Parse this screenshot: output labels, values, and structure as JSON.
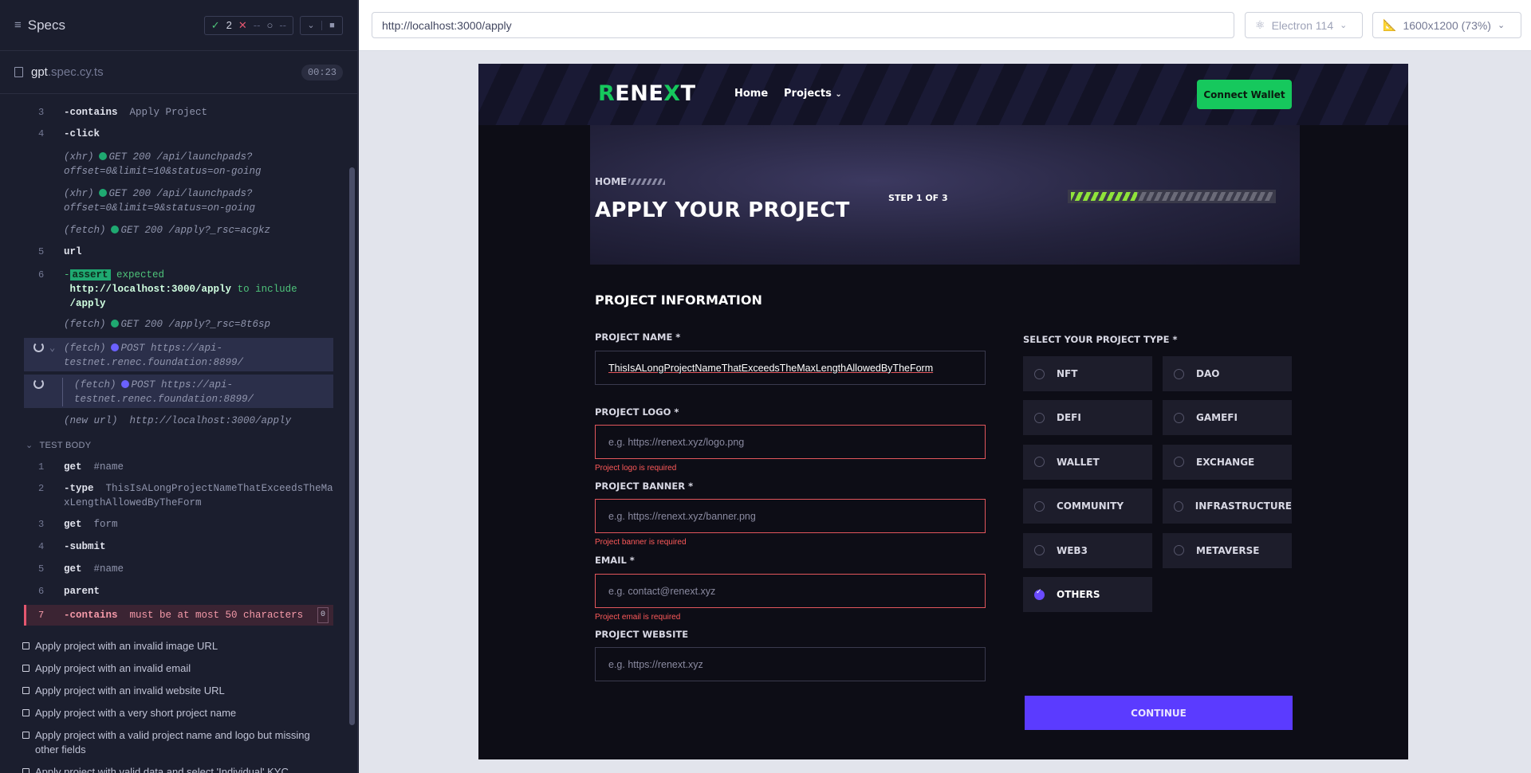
{
  "runner": {
    "title": "Specs",
    "stats": {
      "passed": "2",
      "failed": "--",
      "pending": "--"
    },
    "file": {
      "name": "gpt",
      "ext": ".spec.cy.ts",
      "duration": "00:23"
    },
    "log": [
      {
        "n": "3",
        "kw": "-contains",
        "arg": "Apply Project"
      },
      {
        "n": "4",
        "kw": "-click",
        "arg": ""
      },
      {
        "pre": "(xhr)",
        "text": "GET 200 /api/launchpads?offset=0&limit=10&status=on-going"
      },
      {
        "pre": "(xhr)",
        "text": "GET 200 /api/launchpads?offset=0&limit=9&status=on-going"
      },
      {
        "pre": "(fetch)",
        "text": "GET 200 /apply?_rsc=acgkz"
      },
      {
        "n": "5",
        "kw": "url"
      },
      {
        "n": "6",
        "kw": "-",
        "badge": "assert",
        "pre_text": "expected",
        "url": "http://localhost:3000/apply",
        "mid": "to include",
        "tail": "/apply"
      },
      {
        "pre": "(fetch)",
        "text": "GET 200 /apply?_rsc=8t6sp"
      },
      {
        "pre": "(fetch)",
        "text": "POST https://api-testnet.renec.foundation:8899/"
      },
      {
        "pre": "(fetch)",
        "text": "POST https://api-testnet.renec.foundation:8899/"
      },
      {
        "pre": "(new url)",
        "text": "http://localhost:3000/apply"
      }
    ],
    "test_body_label": "TEST BODY",
    "body": [
      {
        "n": "1",
        "kw": "get",
        "arg": "#name"
      },
      {
        "n": "2",
        "kw": "-type",
        "arg": "ThisIsALongProjectNameThatExceedsTheMaxLengthAllowedByTheForm"
      },
      {
        "n": "3",
        "kw": "get",
        "arg": "form"
      },
      {
        "n": "4",
        "kw": "-submit",
        "arg": ""
      },
      {
        "n": "5",
        "kw": "get",
        "arg": "#name"
      },
      {
        "n": "6",
        "kw": "parent",
        "arg": ""
      },
      {
        "n": "7",
        "kw": "-contains",
        "arg": "must be at most 50 characters",
        "count": "0"
      }
    ],
    "tests": [
      "Apply project with an invalid image URL",
      "Apply project with an invalid email",
      "Apply project with an invalid website URL",
      "Apply project with a very short project name",
      "Apply project with a valid project name and logo but missing other fields",
      "Apply project with valid data and select 'Individual' KYC"
    ]
  },
  "browser": {
    "url": "http://localhost:3000/apply",
    "engine": "Electron 114",
    "viewport": "1600x1200 (73%)"
  },
  "app": {
    "logo": {
      "r": "R",
      "ene": "ENE",
      "x": "X",
      "t": "T"
    },
    "nav": {
      "home": "Home",
      "projects": "Projects"
    },
    "connect": "Connect Wallet",
    "breadcrumb": "HOME",
    "heading": "APPLY YOUR PROJECT",
    "step": "STEP 1 OF 3",
    "progress": 0.33,
    "section": "PROJECT INFORMATION",
    "fields": {
      "name": {
        "label": "PROJECT NAME *",
        "value": "ThisIsALongProjectNameThatExceedsTheMaxLengthAllowedByTheForm"
      },
      "logo": {
        "label": "PROJECT LOGO *",
        "placeholder": "e.g.  https://renext.xyz/logo.png",
        "error": "Project logo is required"
      },
      "banner": {
        "label": "PROJECT BANNER *",
        "placeholder": "e.g.  https://renext.xyz/banner.png",
        "error": "Project banner is required"
      },
      "email": {
        "label": "EMAIL *",
        "placeholder": "e.g.  contact@renext.xyz",
        "error": "Project email is required"
      },
      "website": {
        "label": "PROJECT WEBSITE",
        "placeholder": "e.g.  https://renext.xyz"
      }
    },
    "type_label": "SELECT YOUR PROJECT TYPE *",
    "types": [
      "NFT",
      "DAO",
      "DEFI",
      "GAMEFI",
      "WALLET",
      "EXCHANGE",
      "COMMUNITY",
      "INFRASTRUCTURE",
      "WEB3",
      "METAVERSE",
      "OTHERS"
    ],
    "selected_type": "OTHERS",
    "continue": "CONTINUE",
    "colors": {
      "accent": "#16c85d",
      "primary": "#5b3bff",
      "error": "#e2565c"
    }
  }
}
